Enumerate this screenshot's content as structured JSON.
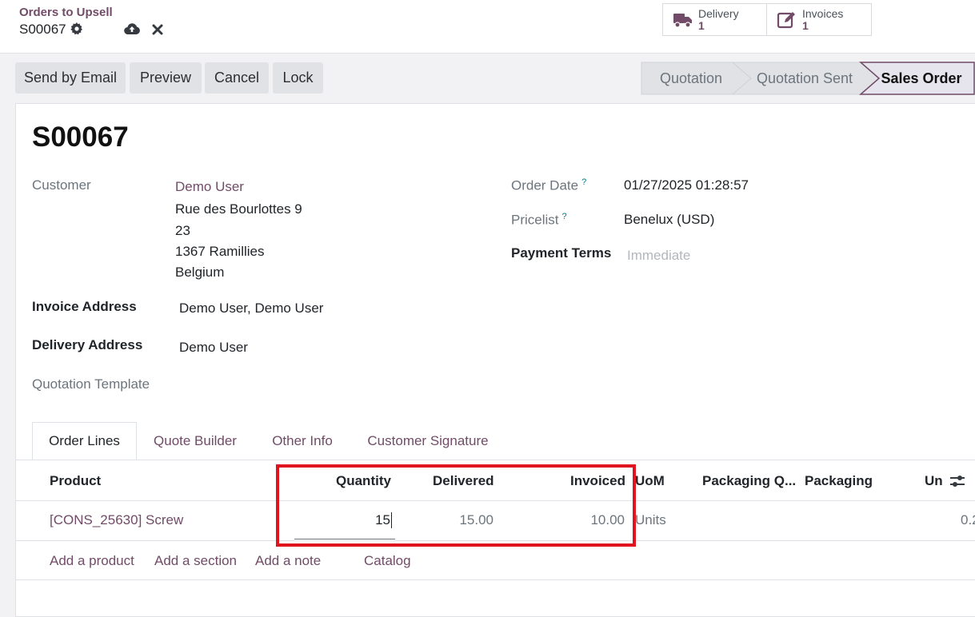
{
  "header": {
    "breadcrumb": "Orders to Upsell",
    "record": "S00067",
    "icons": [
      "gear-icon",
      "cloud-upload-icon",
      "close-icon"
    ],
    "smart_buttons": [
      {
        "label": "Delivery",
        "count": "1",
        "icon": "truck-icon"
      },
      {
        "label": "Invoices",
        "count": "1",
        "icon": "edit-icon"
      }
    ]
  },
  "actions": {
    "send_email": "Send by Email",
    "preview": "Preview",
    "cancel": "Cancel",
    "lock": "Lock"
  },
  "statusbar": {
    "steps": [
      "Quotation",
      "Quotation Sent",
      "Sales Order"
    ],
    "active": "Sales Order"
  },
  "form": {
    "title": "S00067",
    "customer_label": "Customer",
    "customer_name": "Demo User",
    "address_lines": [
      "Rue des Bourlottes 9",
      "23",
      "1367 Ramillies",
      "Belgium"
    ],
    "invoice_address_label": "Invoice Address",
    "invoice_address": "Demo User, Demo User",
    "delivery_address_label": "Delivery Address",
    "delivery_address": "Demo User",
    "quotation_template_label": "Quotation Template",
    "order_date_label": "Order Date",
    "order_date": "01/27/2025 01:28:57",
    "pricelist_label": "Pricelist",
    "pricelist": "Benelux (USD)",
    "payment_terms_label": "Payment Terms",
    "payment_terms_placeholder": "Immediate",
    "help_mark": "?"
  },
  "tabs": [
    "Order Lines",
    "Quote Builder",
    "Other Info",
    "Customer Signature"
  ],
  "table": {
    "headers": [
      "Product",
      "Quantity",
      "Delivered",
      "Invoiced",
      "UoM",
      "Packaging Q...",
      "Packaging",
      "Un"
    ],
    "rows": [
      {
        "product": "[CONS_25630] Screw",
        "quantity": "15",
        "delivered": "15.00",
        "invoiced": "10.00",
        "uom": "Units",
        "unit_price": "0.2"
      }
    ],
    "add_links": [
      "Add a product",
      "Add a section",
      "Add a note",
      "Catalog"
    ]
  },
  "colors": {
    "brand": "#714b67",
    "highlight": "#e0141e",
    "active_step_bg": "#e6e4ed"
  }
}
